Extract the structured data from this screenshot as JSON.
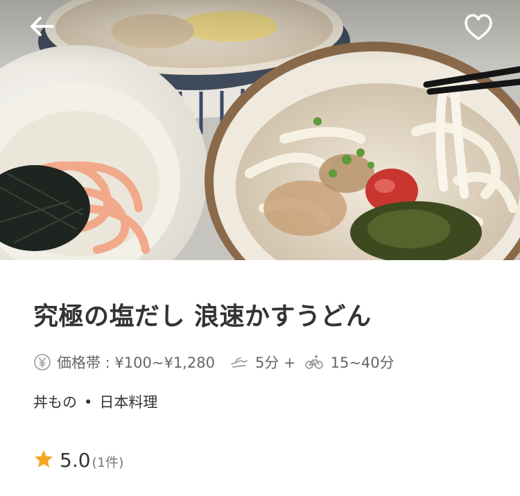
{
  "header": {
    "back_icon": "arrow-left-icon",
    "favorite_icon": "heart-outline-icon"
  },
  "hero": {
    "image_subject": "udon-bowls-photo"
  },
  "restaurant": {
    "name": "究極の塩だし 浪速かすうどん",
    "price_label": "価格帯 : ¥100~¥1,280",
    "prep_time": "5分 +",
    "delivery_time": "15~40分",
    "categories": [
      "丼もの",
      "日本料理"
    ],
    "category_separator": "•",
    "rating_score": "5.0",
    "rating_count": "(1件)"
  },
  "colors": {
    "star": "#f5a623",
    "meta_text": "#666666",
    "title_text": "#333333"
  }
}
